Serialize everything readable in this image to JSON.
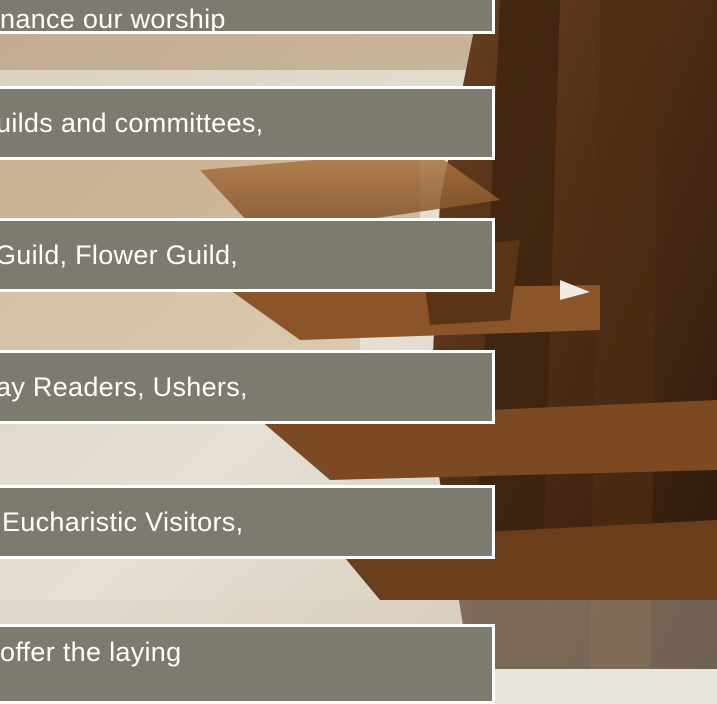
{
  "banners": [
    {
      "text": "nance our worship"
    },
    {
      "text": "uilds and committees,"
    },
    {
      "text": "Guild, Flower Guild,"
    },
    {
      "text": "ay Readers, Ushers,"
    },
    {
      "text": "Eucharistic Visitors,"
    },
    {
      "text": "offer the laying"
    }
  ],
  "colors": {
    "banner_fill": "#7d7b6f",
    "banner_border": "#ffffff",
    "banner_text": "#ffffff"
  }
}
